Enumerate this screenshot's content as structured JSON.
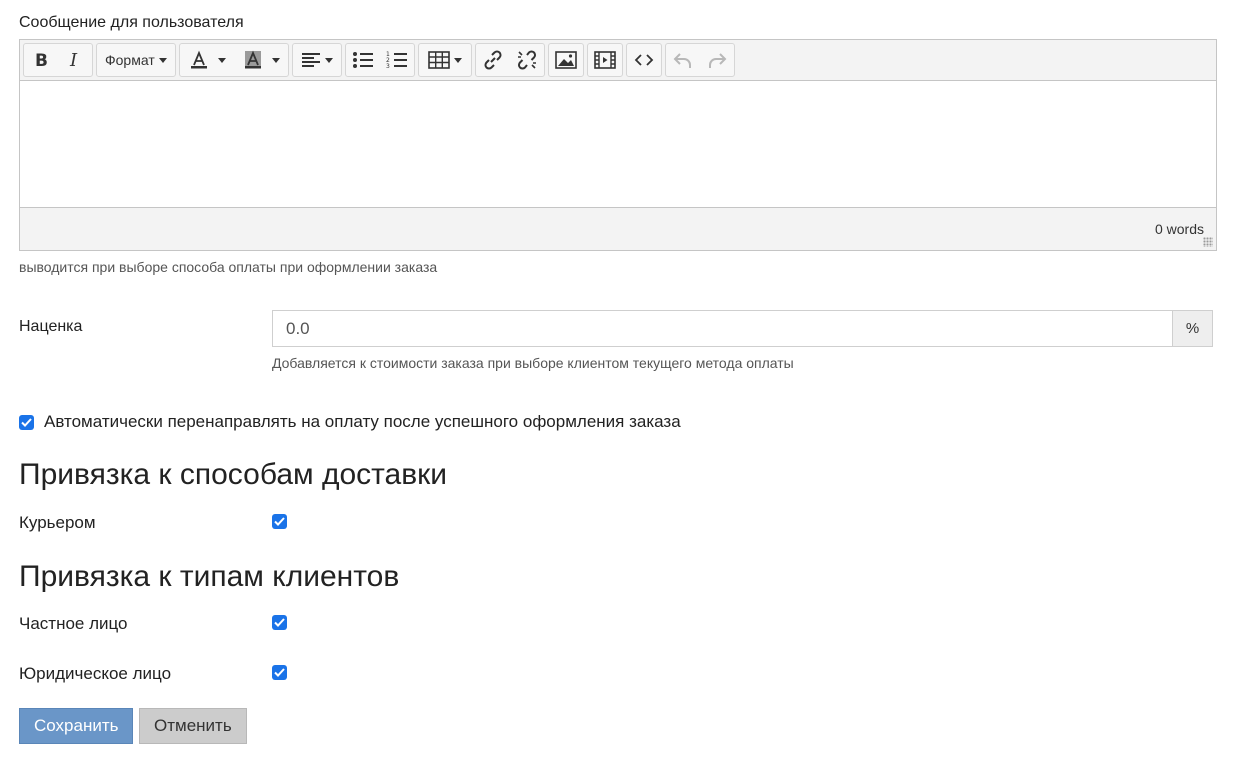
{
  "editor": {
    "label": "Сообщение для пользователя",
    "toolbar": {
      "format_label": "Формат",
      "icons": [
        "bold-icon",
        "italic-icon",
        "text-color-icon",
        "background-color-icon",
        "align-icon",
        "bullet-list-icon",
        "numbered-list-icon",
        "table-icon",
        "link-icon",
        "unlink-icon",
        "image-icon",
        "media-icon",
        "code-icon",
        "undo-icon",
        "redo-icon"
      ]
    },
    "content": "",
    "word_count": "0 words",
    "help": "выводится при выборе способа оплаты при оформлении заказа"
  },
  "markup": {
    "label": "Наценка",
    "value": "0.0",
    "addon": "%",
    "help": "Добавляется к стоимости заказа при выборе клиентом текущего метода оплаты"
  },
  "auto_redirect": {
    "label": "Автоматически перенаправлять на оплату после успешного оформления заказа",
    "checked": true
  },
  "delivery": {
    "title": "Привязка к способам доставки",
    "items": [
      {
        "label": "Курьером",
        "checked": true
      }
    ]
  },
  "client_types": {
    "title": "Привязка к типам клиентов",
    "items": [
      {
        "label": "Частное лицо",
        "checked": true
      },
      {
        "label": "Юридическое лицо",
        "checked": true
      }
    ]
  },
  "actions": {
    "save_label": "Сохранить",
    "cancel_label": "Отменить"
  },
  "colors": {
    "checkbox": "#1a73e8",
    "save_button": "#6a96c8",
    "cancel_button": "#cccccc"
  }
}
